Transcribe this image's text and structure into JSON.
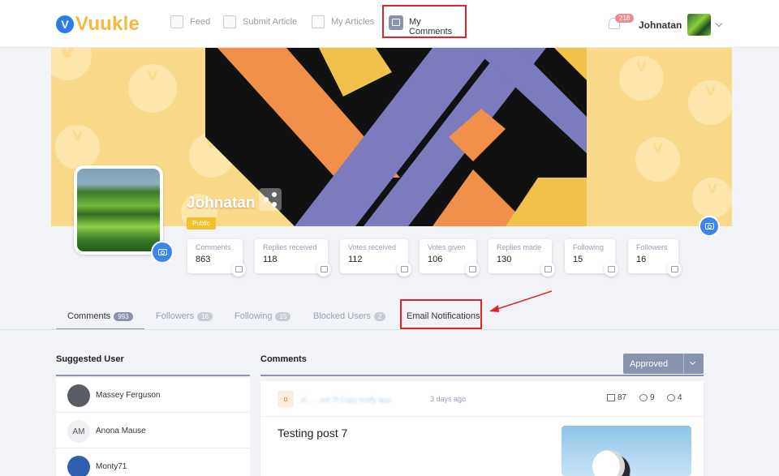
{
  "header": {
    "logo_text": "Vuukle",
    "logo_mark": "V",
    "nav": [
      {
        "label": "Feed",
        "icon": "grid-icon"
      },
      {
        "label": "Submit Article",
        "icon": "document-plus-icon"
      },
      {
        "label": "My Articles",
        "icon": "articles-icon"
      },
      {
        "label": "My Comments",
        "icon": "comment-icon"
      }
    ],
    "notifications_count": "218",
    "username": "Johnatan"
  },
  "profile": {
    "name": "Johnatan",
    "visibility": "Public"
  },
  "stats": [
    {
      "label": "Comments",
      "value": "863"
    },
    {
      "label": "Replies received",
      "value": "118"
    },
    {
      "label": "Votes received",
      "value": "112"
    },
    {
      "label": "Votes given",
      "value": "106"
    },
    {
      "label": "Replies made",
      "value": "130"
    },
    {
      "label": "Following",
      "value": "15"
    },
    {
      "label": "Followers",
      "value": "16"
    }
  ],
  "tabs": [
    {
      "label": "Comments",
      "count": "993"
    },
    {
      "label": "Followers",
      "count": "16"
    },
    {
      "label": "Following",
      "count": "15"
    },
    {
      "label": "Blocked Users",
      "count": "2"
    },
    {
      "label": "Email Notifications",
      "count": ""
    }
  ],
  "suggested": {
    "title": "Suggested User",
    "users": [
      {
        "name": "Massey Ferguson",
        "initials": ""
      },
      {
        "name": "Anona Mause",
        "initials": "AM"
      },
      {
        "name": "Monty71",
        "initials": ""
      }
    ]
  },
  "comments": {
    "title": "Comments",
    "filter": "Approved",
    "card": {
      "avatar_letter": "o",
      "author_blurred": "ol... ...sot 7f Copy notify app",
      "time": "3 days ago",
      "replies": "87",
      "reactions": "9",
      "likes": "4",
      "title": "Testing post 7"
    }
  },
  "colors": {
    "accent": "#8a93ad",
    "brand_yellow": "#f6b93b",
    "brand_blue": "#2a7de1",
    "highlight_red": "#e0242c",
    "camera_blue": "#3b86ee"
  }
}
